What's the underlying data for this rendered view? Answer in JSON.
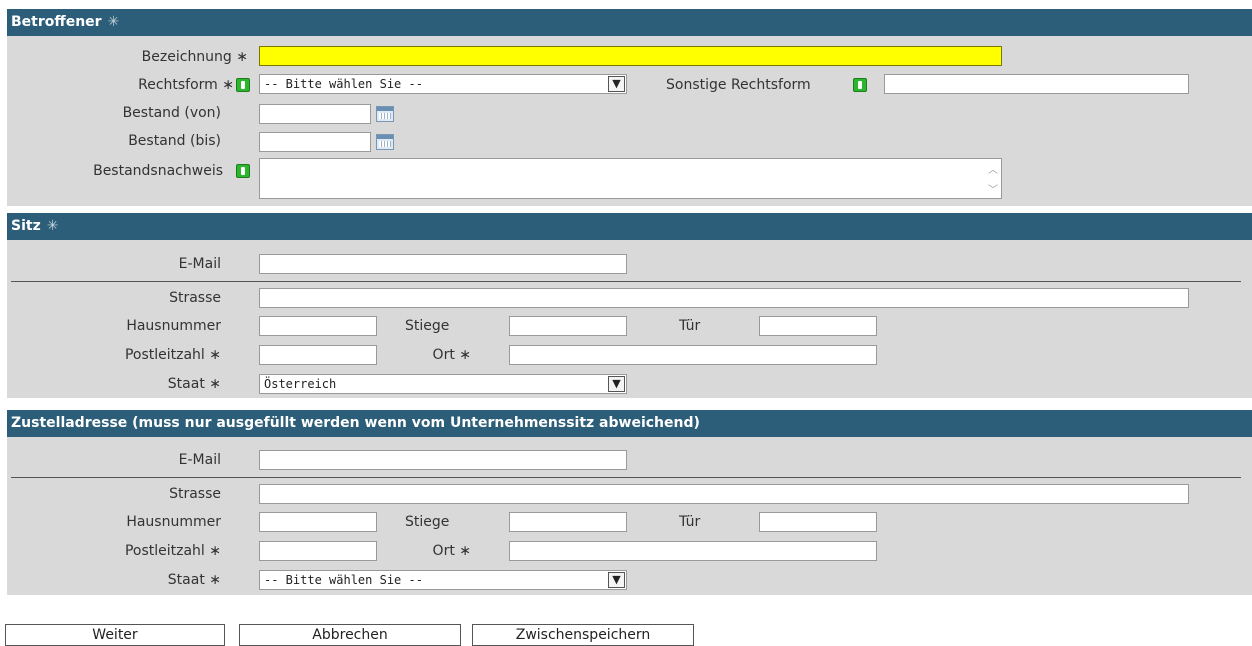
{
  "betroffener": {
    "title": "Betroffener",
    "star": "✳",
    "bezeichnung_label": "Bezeichnung ∗",
    "bezeichnung_value": "",
    "rechtsform_label": "Rechtsform ∗",
    "rechtsform_value": "-- Bitte wählen Sie --",
    "sonstige_label": "Sonstige Rechtsform",
    "sonstige_value": "",
    "bestand_von_label": "Bestand (von)",
    "bestand_bis_label": "Bestand (bis)",
    "bestandsnachweis_label": "Bestandsnachweis"
  },
  "sitz": {
    "title": "Sitz",
    "star": "✳",
    "email_label": "E-Mail",
    "strasse_label": "Strasse",
    "hausnummer_label": "Hausnummer",
    "stiege_label": "Stiege",
    "tuer_label": "Tür",
    "plz_label": "Postleitzahl ∗",
    "ort_label": "Ort ∗",
    "staat_label": "Staat ∗",
    "staat_value": "Österreich"
  },
  "zustell": {
    "title": "Zustelladresse (muss nur ausgefüllt werden wenn vom Unternehmenssitz abweichend)",
    "email_label": "E-Mail",
    "strasse_label": "Strasse",
    "hausnummer_label": "Hausnummer",
    "stiege_label": "Stiege",
    "tuer_label": "Tür",
    "plz_label": "Postleitzahl ∗",
    "ort_label": "Ort ∗",
    "staat_label": "Staat ∗",
    "staat_value": "-- Bitte wählen Sie --"
  },
  "buttons": {
    "weiter": "Weiter",
    "abbrechen": "Abbrechen",
    "zwischenspeichern": "Zwischenspeichern"
  },
  "icons": {
    "info": "info-icon",
    "calendar": "calendar-icon",
    "dropdown": "chevron-down-icon"
  },
  "colors": {
    "header_bg": "#2c5e7a",
    "section_bg": "#d9d9d9",
    "required_highlight": "#ffff00",
    "info_icon": "#2db52d"
  }
}
